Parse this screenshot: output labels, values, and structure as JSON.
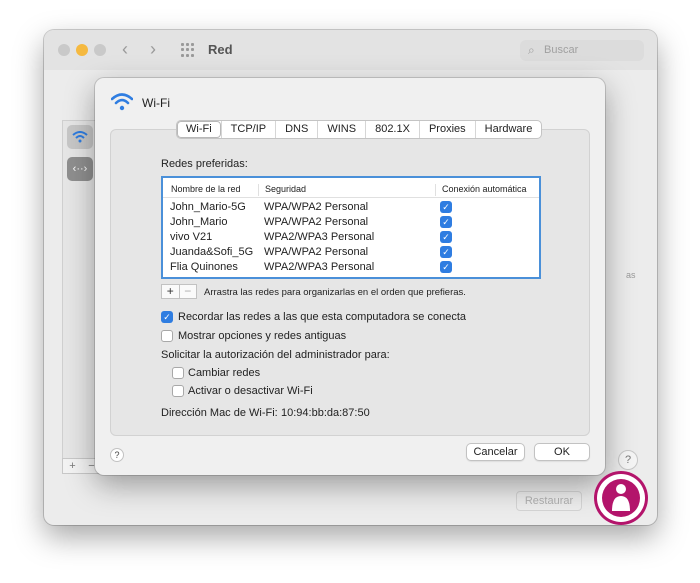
{
  "background_window": {
    "title": "Red",
    "search_placeholder": "Buscar",
    "restore_label": "Restaurar",
    "sidebar_add": "+",
    "sidebar_remove": "−",
    "help": "?",
    "fragment": "as"
  },
  "sheet": {
    "title": "Wi-Fi",
    "tabs": [
      "Wi-Fi",
      "TCP/IP",
      "DNS",
      "WINS",
      "802.1X",
      "Proxies",
      "Hardware"
    ],
    "selected_tab": "Wi-Fi",
    "preferred_networks_label": "Redes preferidas:",
    "table": {
      "headers": [
        "Nombre de la red",
        "Seguridad",
        "Conexión automática"
      ],
      "rows": [
        {
          "name": "John_Mario-5G",
          "security": "WPA/WPA2 Personal",
          "auto": true
        },
        {
          "name": "John_Mario",
          "security": "WPA/WPA2 Personal",
          "auto": true
        },
        {
          "name": "vivo V21",
          "security": "WPA2/WPA3 Personal",
          "auto": true
        },
        {
          "name": "Juanda&Sofi_5G",
          "security": "WPA/WPA2 Personal",
          "auto": true
        },
        {
          "name": "Flia Quinones",
          "security": "WPA2/WPA3 Personal",
          "auto": true
        }
      ]
    },
    "add_label": "+",
    "remove_label": "−",
    "drag_hint": "Arrastra las redes para organizarlas en el orden que prefieras.",
    "remember_networks": {
      "label": "Recordar las redes a las que esta computadora se conecta",
      "checked": true
    },
    "show_legacy": {
      "label": "Mostrar opciones y redes antiguas",
      "checked": false
    },
    "admin_auth_label": "Solicitar la autorización del administrador para:",
    "change_networks": {
      "label": "Cambiar redes",
      "checked": false
    },
    "toggle_wifi": {
      "label": "Activar o desactivar Wi-Fi",
      "checked": false
    },
    "mac_label": "Dirección Mac de Wi-Fi:",
    "mac_value": "10:94:bb:da:87:50",
    "help": "?",
    "cancel_label": "Cancelar",
    "ok_label": "OK"
  },
  "colors": {
    "accent": "#2f7de1",
    "table_focus": "#4a90d9",
    "logo": "#b3146b"
  }
}
